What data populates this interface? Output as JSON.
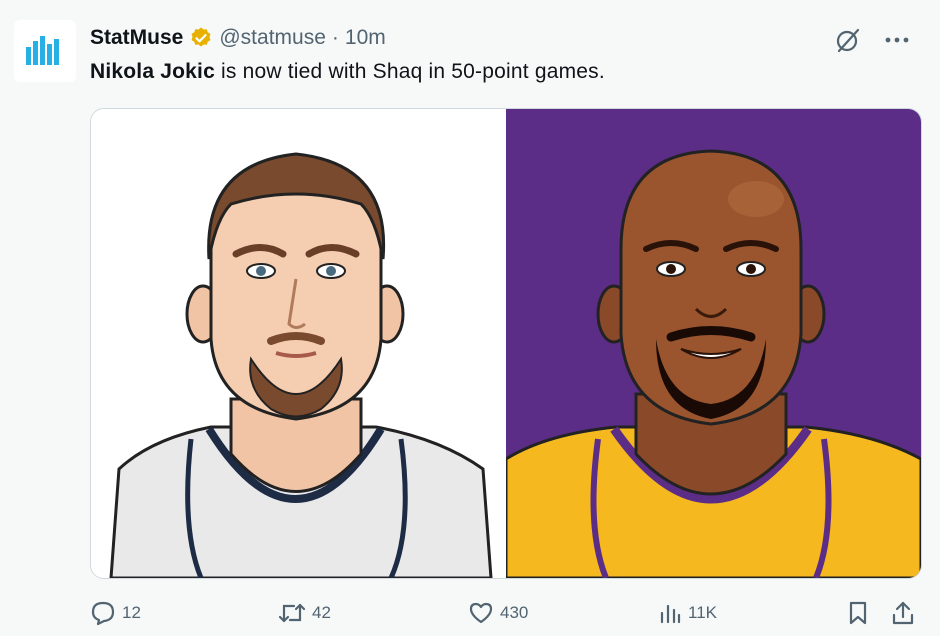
{
  "tweet": {
    "author_name": "StatMuse",
    "handle": "@statmuse",
    "separator": "·",
    "time": "10m",
    "text_mention": "Nikola Jokic",
    "text_rest": " is now tied with Shaq in 50-point games."
  },
  "stats": {
    "replies": "12",
    "retweets": "42",
    "likes": "430",
    "views": "11K"
  },
  "icons": {
    "verified": "verified-badge-icon",
    "grok": "grok-icon",
    "more": "more-icon",
    "reply": "reply-icon",
    "retweet": "retweet-icon",
    "like": "heart-icon",
    "views": "views-icon",
    "bookmark": "bookmark-icon",
    "share": "share-icon"
  },
  "colors": {
    "accent_blue": "#1d9bf0",
    "verified_gold": "#e8b100",
    "lakers_purple": "#5c2d87",
    "lakers_gold": "#f5b81f"
  }
}
